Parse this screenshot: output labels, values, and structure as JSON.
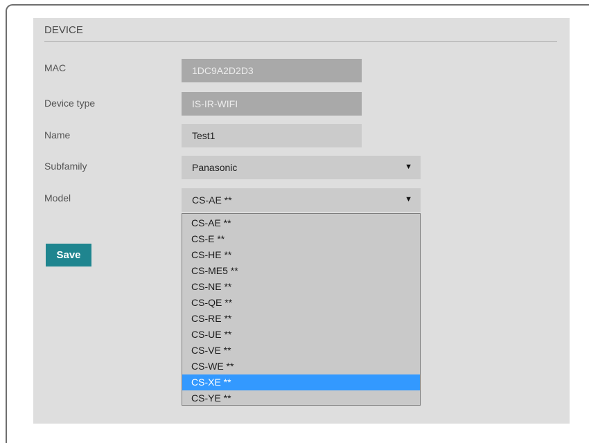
{
  "section": {
    "title": "DEVICE"
  },
  "form": {
    "mac": {
      "label": "MAC",
      "value": "1DC9A2D2D3"
    },
    "device_type": {
      "label": "Device type",
      "value": "IS-IR-WIFI"
    },
    "name": {
      "label": "Name",
      "value": "Test1"
    },
    "subfamily": {
      "label": "Subfamily",
      "value": "Panasonic"
    },
    "model": {
      "label": "Model",
      "value": "CS-AE **"
    }
  },
  "save_label": "Save",
  "model_options": [
    "CS-AE **",
    "CS-E **",
    "CS-HE **",
    "CS-ME5 **",
    "CS-NE **",
    "CS-QE **",
    "CS-RE **",
    "CS-UE **",
    "CS-VE **",
    "CS-WE **",
    "CS-XE **",
    "CS-YE **"
  ],
  "highlighted_option": "CS-XE **",
  "icons": {
    "select_caret": "caret-down-icon"
  },
  "colors": {
    "accent": "#1f858f",
    "highlight": "#3399ff"
  }
}
